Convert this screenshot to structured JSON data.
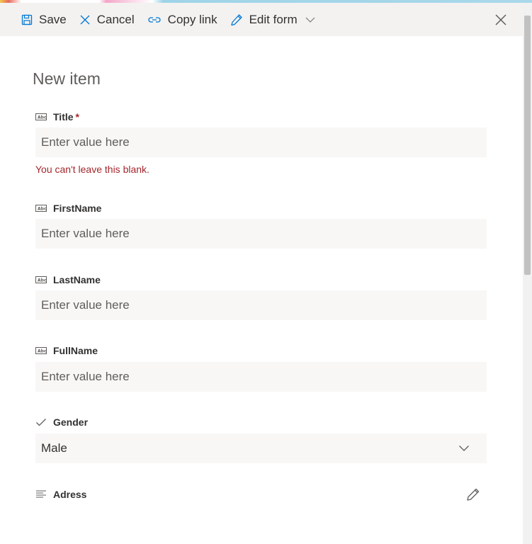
{
  "toolbar": {
    "save_label": "Save",
    "cancel_label": "Cancel",
    "copy_link_label": "Copy link",
    "edit_form_label": "Edit form"
  },
  "form": {
    "title": "New item",
    "fields": [
      {
        "label": "Title",
        "required_mark": "*",
        "placeholder": "Enter value here",
        "error": "You can't leave this blank.",
        "icon": "text-field-icon"
      },
      {
        "label": "FirstName",
        "placeholder": "Enter value here",
        "icon": "text-field-icon"
      },
      {
        "label": "LastName",
        "placeholder": "Enter value here",
        "icon": "text-field-icon"
      },
      {
        "label": "FullName",
        "placeholder": "Enter value here",
        "icon": "text-field-icon"
      },
      {
        "label": "Gender",
        "value": "Male",
        "icon": "checkmark-icon"
      },
      {
        "label": "Adress",
        "icon": "multiline-text-icon"
      }
    ]
  },
  "colors": {
    "error": "#a4262c",
    "command_bar_bg": "#f3f2f1",
    "input_bg": "#f8f7f6",
    "accent": "#0078d4"
  }
}
